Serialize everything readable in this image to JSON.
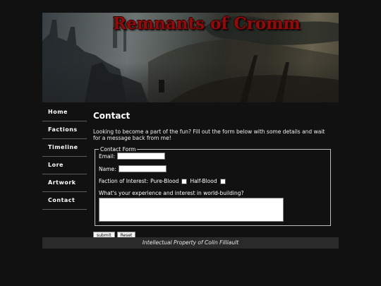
{
  "banner": {
    "title": "Remnants of Cromm"
  },
  "nav": {
    "items": [
      {
        "label": "Home"
      },
      {
        "label": "Factions"
      },
      {
        "label": "Timeline"
      },
      {
        "label": "Lore"
      },
      {
        "label": "Artwork"
      },
      {
        "label": "Contact"
      }
    ]
  },
  "main": {
    "title": "Contact",
    "intro": "Looking to become a part of the fun? Fill out the form below with some details and wait for a message back from me!",
    "form": {
      "legend": "Contact Form",
      "email_label": "Email:",
      "email_value": "",
      "name_label": "Name:",
      "name_value": "",
      "faction_label": "Faction of Interest:",
      "faction_options": [
        "Pure-Blood",
        "Half-Blood"
      ],
      "experience_label": "What's your experience and interest in world-building?",
      "experience_value": "",
      "submit_label": "submit",
      "reset_label": "Reset"
    }
  },
  "footer": {
    "text": "Intellectual Property of Colin Filliault"
  },
  "colors": {
    "background": "#111111",
    "title_red": "#8e0c0c",
    "footer_bg": "#2a2a2a"
  }
}
